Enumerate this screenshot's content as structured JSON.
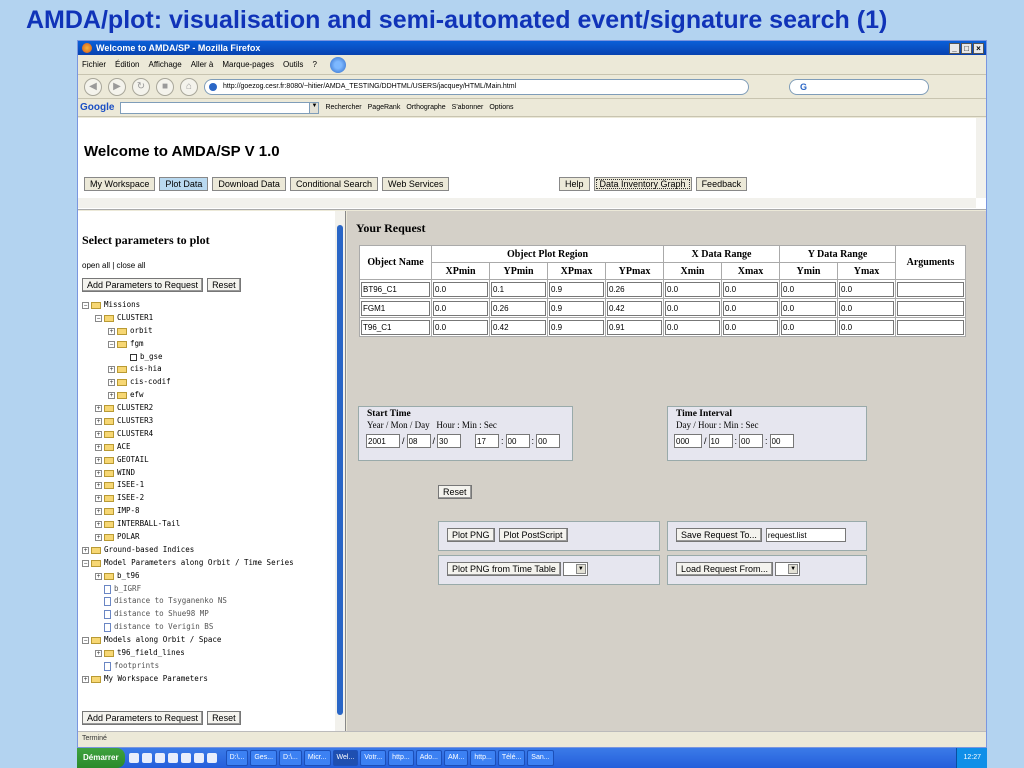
{
  "slide_title": "AMDA/plot: visualisation and semi-automated event/signature search (1)",
  "browser": {
    "title": "Welcome to AMDA/SP - Mozilla Firefox",
    "menu": [
      "Fichier",
      "Édition",
      "Affichage",
      "Aller à",
      "Marque-pages",
      "Outils",
      "?"
    ],
    "url": "http://goezog.cesr.fr:8080/~hitier/AMDA_TESTING/DDHTML/USERS/jacquey/HTML/Main.html",
    "search_engine": "G",
    "google_bar": {
      "logo": "Google",
      "items": [
        "Rechercher",
        "PageRank",
        "Orthographe",
        "S'abonner",
        "Options"
      ]
    },
    "status": "Terminé"
  },
  "page": {
    "welcome": "Welcome to AMDA/SP V 1.0",
    "tabs": [
      "My Workspace",
      "Plot Data",
      "Download Data",
      "Conditional Search",
      "Web Services"
    ],
    "active_tab": "Plot Data",
    "right_tabs": [
      "Help",
      "Data Inventory Graph",
      "Feedback"
    ]
  },
  "left": {
    "title": "Select parameters to plot",
    "links": "open all | close all",
    "add_btn": "Add Parameters to Request",
    "reset_btn": "Reset",
    "tree": [
      {
        "label": "Missions",
        "depth": 0,
        "kind": "folder",
        "sign": "-"
      },
      {
        "label": "CLUSTER1",
        "depth": 1,
        "kind": "folder",
        "sign": "-"
      },
      {
        "label": "orbit",
        "depth": 2,
        "kind": "folder",
        "sign": "+"
      },
      {
        "label": "fgm",
        "depth": 2,
        "kind": "folder",
        "sign": "-"
      },
      {
        "label": "b_gse",
        "depth": 3,
        "kind": "check"
      },
      {
        "label": "cis-hia",
        "depth": 2,
        "kind": "folder",
        "sign": "+"
      },
      {
        "label": "cis-codif",
        "depth": 2,
        "kind": "folder",
        "sign": "+"
      },
      {
        "label": "efw",
        "depth": 2,
        "kind": "folder",
        "sign": "+"
      },
      {
        "label": "CLUSTER2",
        "depth": 1,
        "kind": "folder",
        "sign": "+"
      },
      {
        "label": "CLUSTER3",
        "depth": 1,
        "kind": "folder",
        "sign": "+"
      },
      {
        "label": "CLUSTER4",
        "depth": 1,
        "kind": "folder",
        "sign": "+"
      },
      {
        "label": "ACE",
        "depth": 1,
        "kind": "folder",
        "sign": "+"
      },
      {
        "label": "GEOTAIL",
        "depth": 1,
        "kind": "folder",
        "sign": "+"
      },
      {
        "label": "WIND",
        "depth": 1,
        "kind": "folder",
        "sign": "+"
      },
      {
        "label": "ISEE-1",
        "depth": 1,
        "kind": "folder",
        "sign": "+"
      },
      {
        "label": "ISEE-2",
        "depth": 1,
        "kind": "folder",
        "sign": "+"
      },
      {
        "label": "IMP-8",
        "depth": 1,
        "kind": "folder",
        "sign": "+"
      },
      {
        "label": "INTERBALL-Tail",
        "depth": 1,
        "kind": "folder",
        "sign": "+"
      },
      {
        "label": "POLAR",
        "depth": 1,
        "kind": "folder",
        "sign": "+"
      },
      {
        "label": "Ground-based Indices",
        "depth": 0,
        "kind": "folder",
        "sign": "+"
      },
      {
        "label": "Model Parameters along Orbit / Time Series",
        "depth": 0,
        "kind": "folder",
        "sign": "-"
      },
      {
        "label": "b_t96",
        "depth": 1,
        "kind": "folder",
        "sign": "+"
      },
      {
        "label": "b_IGRF",
        "depth": 1,
        "kind": "doc"
      },
      {
        "label": "distance to Tsyganenko NS",
        "depth": 1,
        "kind": "doc"
      },
      {
        "label": "distance to Shue98 MP",
        "depth": 1,
        "kind": "doc"
      },
      {
        "label": "distance to Verigin BS",
        "depth": 1,
        "kind": "doc"
      },
      {
        "label": "Models along Orbit / Space",
        "depth": 0,
        "kind": "folder",
        "sign": "-"
      },
      {
        "label": "t96_field_lines",
        "depth": 1,
        "kind": "folder",
        "sign": "+"
      },
      {
        "label": "footprints",
        "depth": 1,
        "kind": "doc"
      },
      {
        "label": "My Workspace Parameters",
        "depth": 0,
        "kind": "folder",
        "sign": "+"
      }
    ]
  },
  "request": {
    "title": "Your Request",
    "headers": {
      "object_name": "Object Name",
      "plot_region": "Object Plot Region",
      "x_range": "X Data Range",
      "y_range": "Y Data Range",
      "arguments": "Arguments",
      "sub": [
        "XPmin",
        "YPmin",
        "XPmax",
        "YPmax",
        "Xmin",
        "Xmax",
        "Ymin",
        "Ymax"
      ]
    },
    "rows": [
      {
        "name": "BT96_C1",
        "vals": [
          "0.0",
          "0.1",
          "0.9",
          "0.26",
          "0.0",
          "0.0",
          "0.0",
          "0.0"
        ],
        "args": ""
      },
      {
        "name": "FGM1",
        "vals": [
          "0.0",
          "0.26",
          "0.9",
          "0.42",
          "0.0",
          "0.0",
          "0.0",
          "0.0"
        ],
        "args": ""
      },
      {
        "name": "T96_C1",
        "vals": [
          "0.0",
          "0.42",
          "0.9",
          "0.91",
          "0.0",
          "0.0",
          "0.0",
          "0.0"
        ],
        "args": ""
      }
    ],
    "start_time": {
      "title": "Start Time",
      "sub": "Year / Mon / Day   Hour : Min : Sec",
      "year": "2001",
      "mon": "08",
      "day": "30",
      "hour": "17",
      "min": "00",
      "sec": "00"
    },
    "time_interval": {
      "title": "Time Interval",
      "sub": "Day / Hour : Min : Sec",
      "day": "000",
      "hour": "10",
      "min": "00",
      "sec": "00"
    },
    "reset": "Reset",
    "plot_png": "Plot PNG",
    "plot_ps": "Plot PostScript",
    "save_req": "Save Request To...",
    "save_file": "request.list",
    "plot_tt": "Plot PNG from Time Table",
    "load_req": "Load Request From..."
  },
  "taskbar": {
    "start": "Démarrer",
    "tasks": [
      "D:\\...",
      "Ges...",
      "D:\\...",
      "Micr...",
      "Wel...",
      "Votr...",
      "http...",
      "Ado...",
      "AM...",
      "http...",
      "Télé...",
      "San..."
    ],
    "active_task": "Wel...",
    "clock": "12:27"
  }
}
